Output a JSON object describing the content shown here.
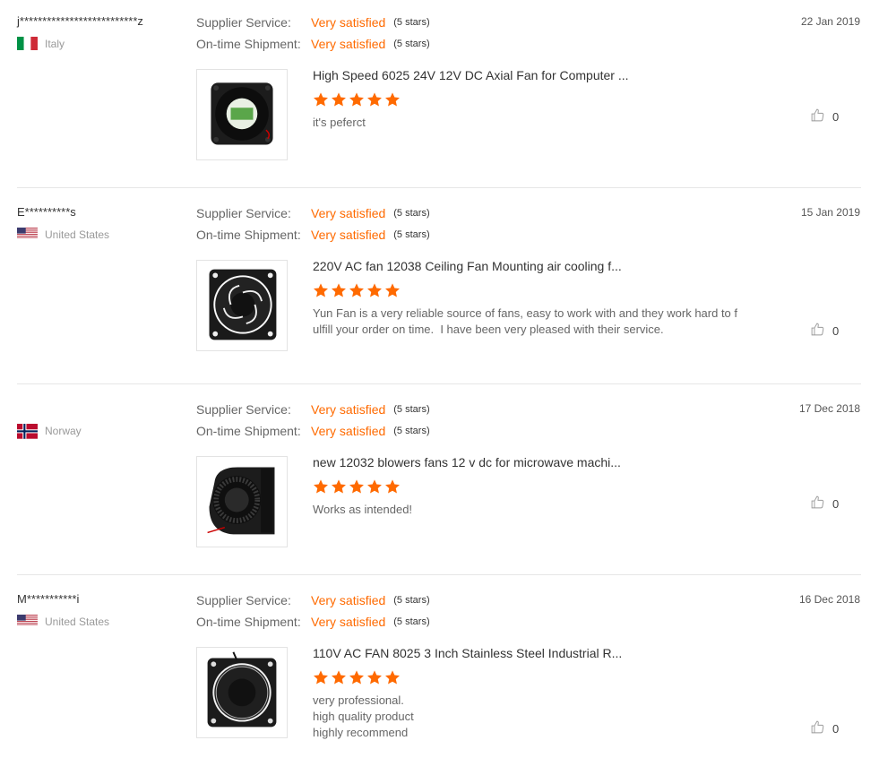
{
  "labels": {
    "supplier_service": "Supplier Service:",
    "ontime_shipment": "On-time Shipment:"
  },
  "colors": {
    "accent": "#ff6a00",
    "divider": "#e6e6e6"
  },
  "reviews": [
    {
      "user": "j**************************z",
      "country": "Italy",
      "flag": "italy-flag",
      "supplier_value": "Very satisfied",
      "supplier_stars": "(5 stars)",
      "shipment_value": "Very satisfied",
      "shipment_stars": "(5 stars)",
      "date": "22 Jan 2019",
      "product_title": "High Speed 6025 24V 12V DC Axial Fan for Computer ...",
      "product_image": "axial-fan-image",
      "rating": 5,
      "feedback": "it's peferct",
      "likes": "0"
    },
    {
      "user": "E**********s",
      "country": "United States",
      "flag": "usa-flag",
      "supplier_value": "Very satisfied",
      "supplier_stars": "(5 stars)",
      "shipment_value": "Very satisfied",
      "shipment_stars": "(5 stars)",
      "date": "15 Jan 2019",
      "product_title": "220V AC fan 12038 Ceiling Fan Mounting air cooling f...",
      "product_image": "ac-fan-image",
      "rating": 5,
      "feedback": "Yun Fan is a very reliable source of fans, easy to work with and they work hard to f\nulfill your order on time.  I have been very pleased with their service.",
      "likes": "0"
    },
    {
      "user": "",
      "country": "Norway",
      "flag": "norway-flag",
      "supplier_value": "Very satisfied",
      "supplier_stars": "(5 stars)",
      "shipment_value": "Very satisfied",
      "shipment_stars": "(5 stars)",
      "date": "17 Dec 2018",
      "product_title": "new 12032 blowers fans 12 v dc for microwave machi...",
      "product_image": "blower-fan-image",
      "rating": 5,
      "feedback": "Works as intended!",
      "likes": "0"
    },
    {
      "user": "M***********i",
      "country": "United States",
      "flag": "usa-flag",
      "supplier_value": "Very satisfied",
      "supplier_stars": "(5 stars)",
      "shipment_value": "Very satisfied",
      "shipment_stars": "(5 stars)",
      "date": "16 Dec 2018",
      "product_title": "110V AC FAN 8025 3 Inch Stainless Steel Industrial R...",
      "product_image": "industrial-fan-image",
      "rating": 5,
      "feedback": "very professional.\nhigh quality product\nhighly recommend",
      "likes": "0"
    }
  ]
}
